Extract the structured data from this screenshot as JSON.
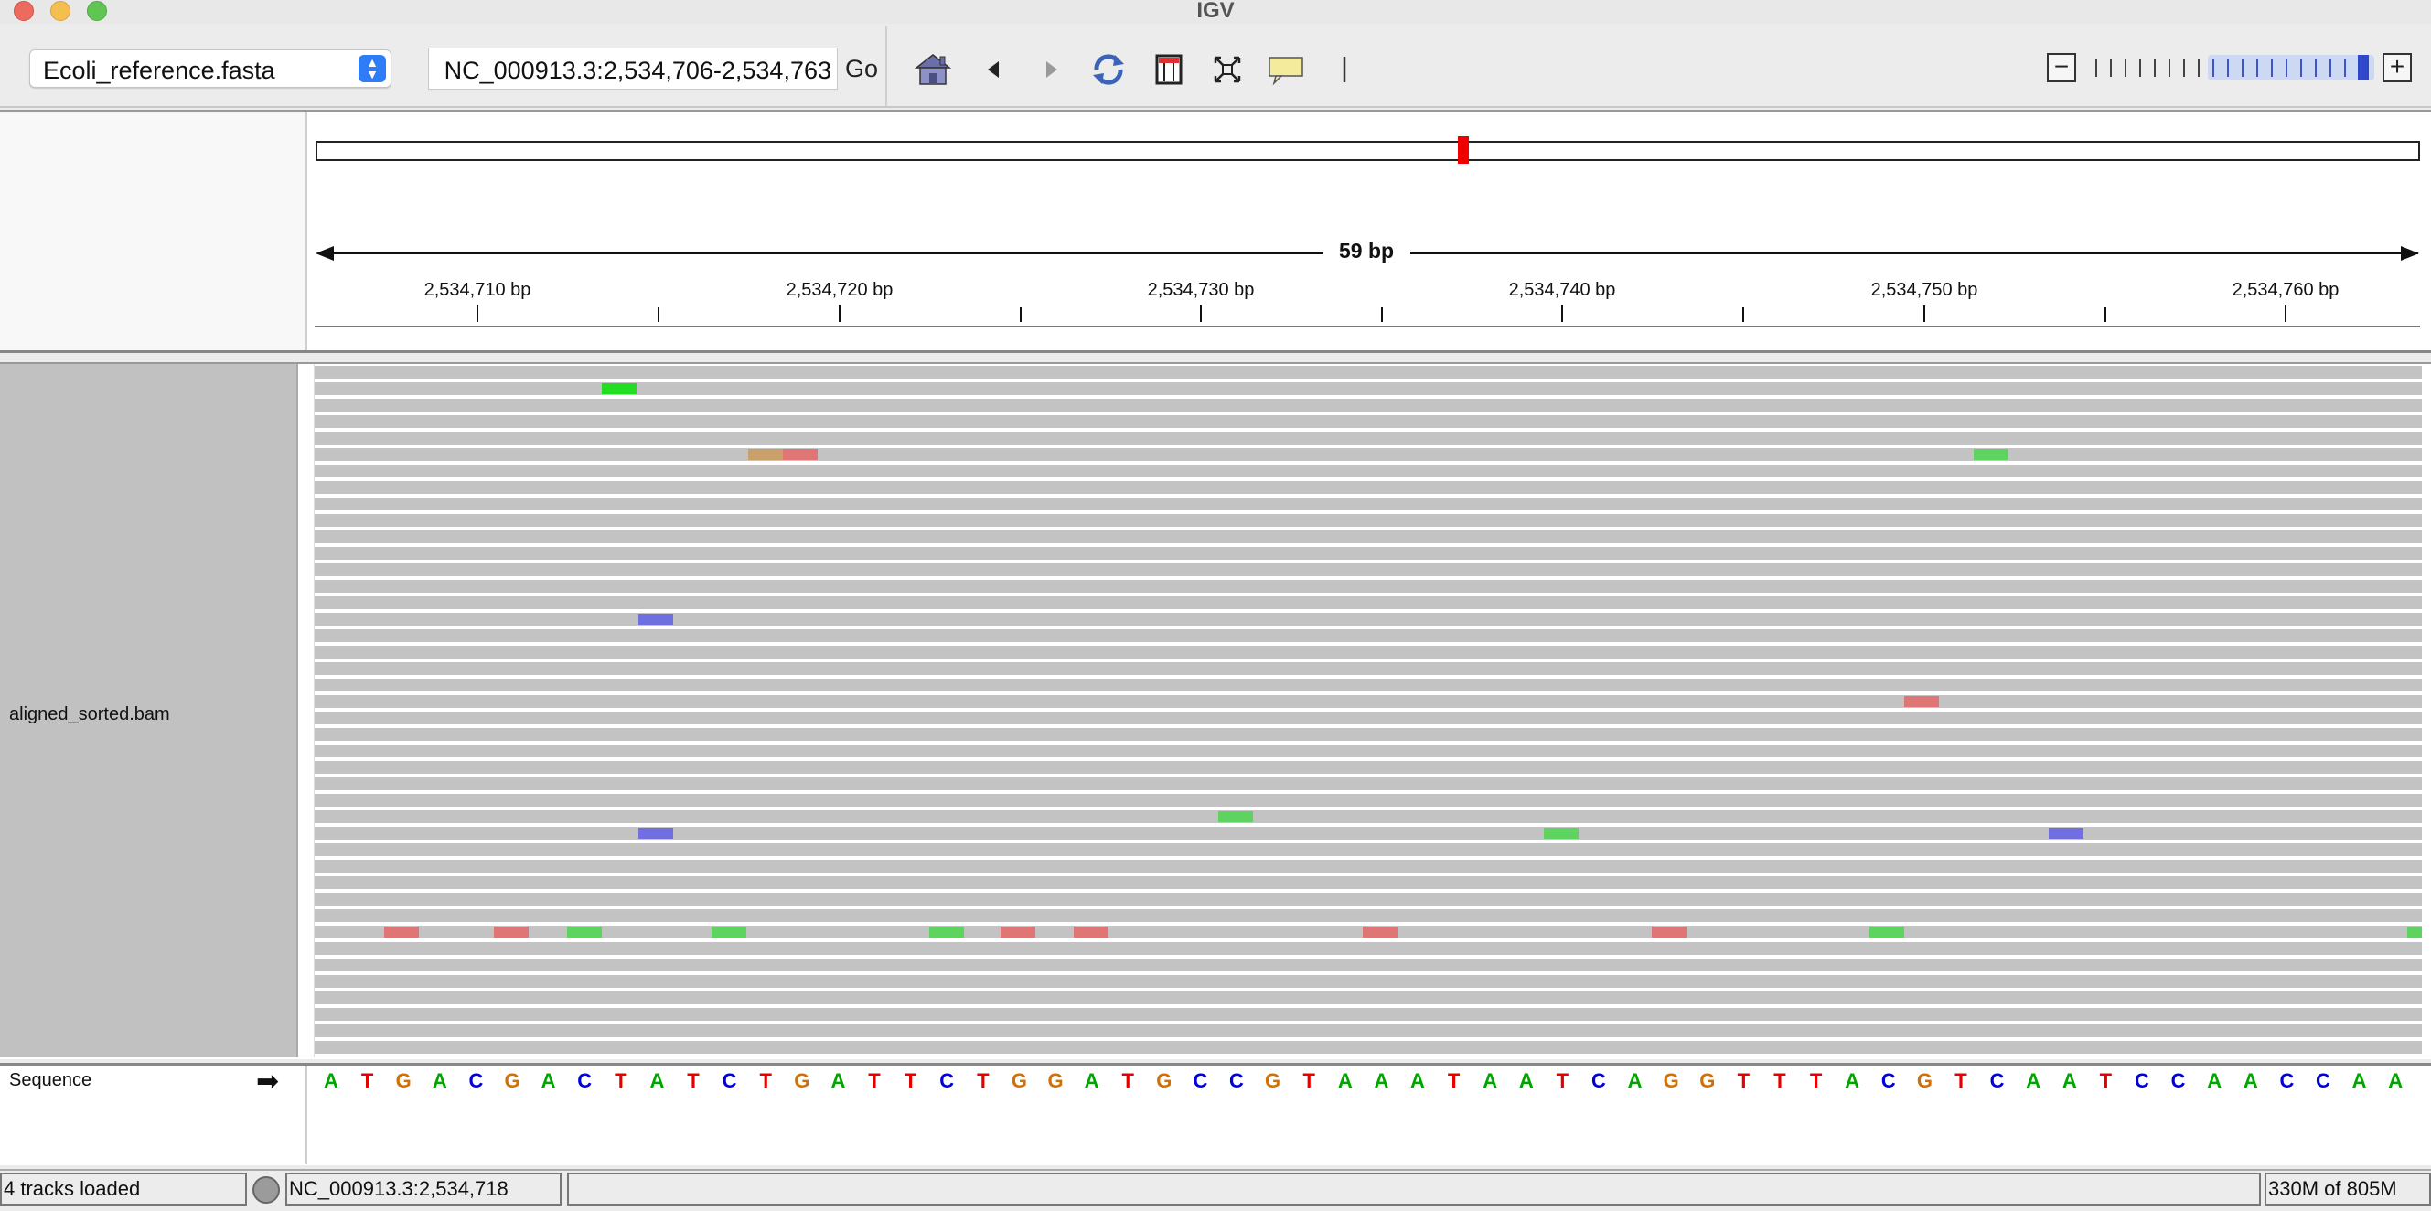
{
  "window": {
    "title": "IGV"
  },
  "toolbar": {
    "genome": "Ecoli_reference.fasta",
    "locus": "NC_000913.3:2,534,706-2,534,763",
    "go_label": "Go"
  },
  "ruler": {
    "span_label": "59 bp",
    "ticks": [
      "2,534,710 bp",
      "2,534,720 bp",
      "2,534,730 bp",
      "2,534,740 bp",
      "2,534,750 bp",
      "2,534,760 bp"
    ]
  },
  "tracks": {
    "alignment_name": "aligned_sorted.bam",
    "sequence_name": "Sequence"
  },
  "sequence": {
    "bases": "ATGACGACTATCTGATTCTGGATGCCGTAAATAATCAGGTTTACGTCAATCCAACCAA",
    "colors": {
      "A": "#00a600",
      "C": "#0000d8",
      "G": "#d17105",
      "T": "#e50000"
    }
  },
  "mismatch_colors": {
    "A": "#5fd35f",
    "C": "#6f6fe0",
    "G": "#c9a06a",
    "T": "#e07575",
    "A_strong": "#22dd22"
  },
  "status": {
    "tracks_loaded": "4 tracks loaded",
    "position": "NC_000913.3:2,534,718",
    "memory": "330M of 805M"
  }
}
